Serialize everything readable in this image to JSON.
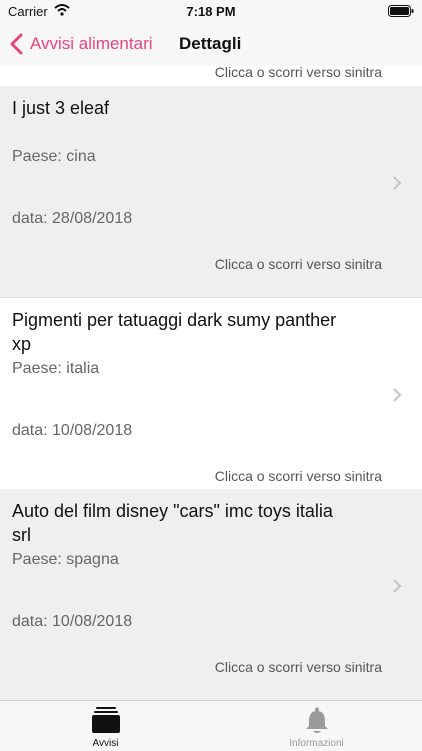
{
  "status_bar": {
    "carrier": "Carrier",
    "time": "7:18 PM"
  },
  "nav": {
    "back_label": "Avvisi alimentari",
    "title": "Dettagli"
  },
  "colors": {
    "accent": "#e8457a"
  },
  "list": {
    "partial_hint": "Clicca o scorri verso sinitra",
    "rows": [
      {
        "title": "I just 3 eleaf",
        "country": "Paese: cina",
        "date": "data: 28/08/2018",
        "hint": "Clicca o scorri verso sinitra"
      },
      {
        "title": "Pigmenti per tatuaggi dark sumy panther xp",
        "country": "Paese: italia",
        "date": "data: 10/08/2018",
        "hint": "Clicca o scorri verso sinitra"
      },
      {
        "title": "Auto del film disney \"cars\" imc toys italia srl",
        "country": "Paese: spagna",
        "date": "data: 10/08/2018",
        "hint": "Clicca o scorri verso sinitra"
      }
    ]
  },
  "tabs": [
    {
      "label": "Avvisi",
      "icon": "stack-icon",
      "selected": true
    },
    {
      "label": "Informazioni",
      "icon": "bell-icon",
      "selected": false
    }
  ]
}
